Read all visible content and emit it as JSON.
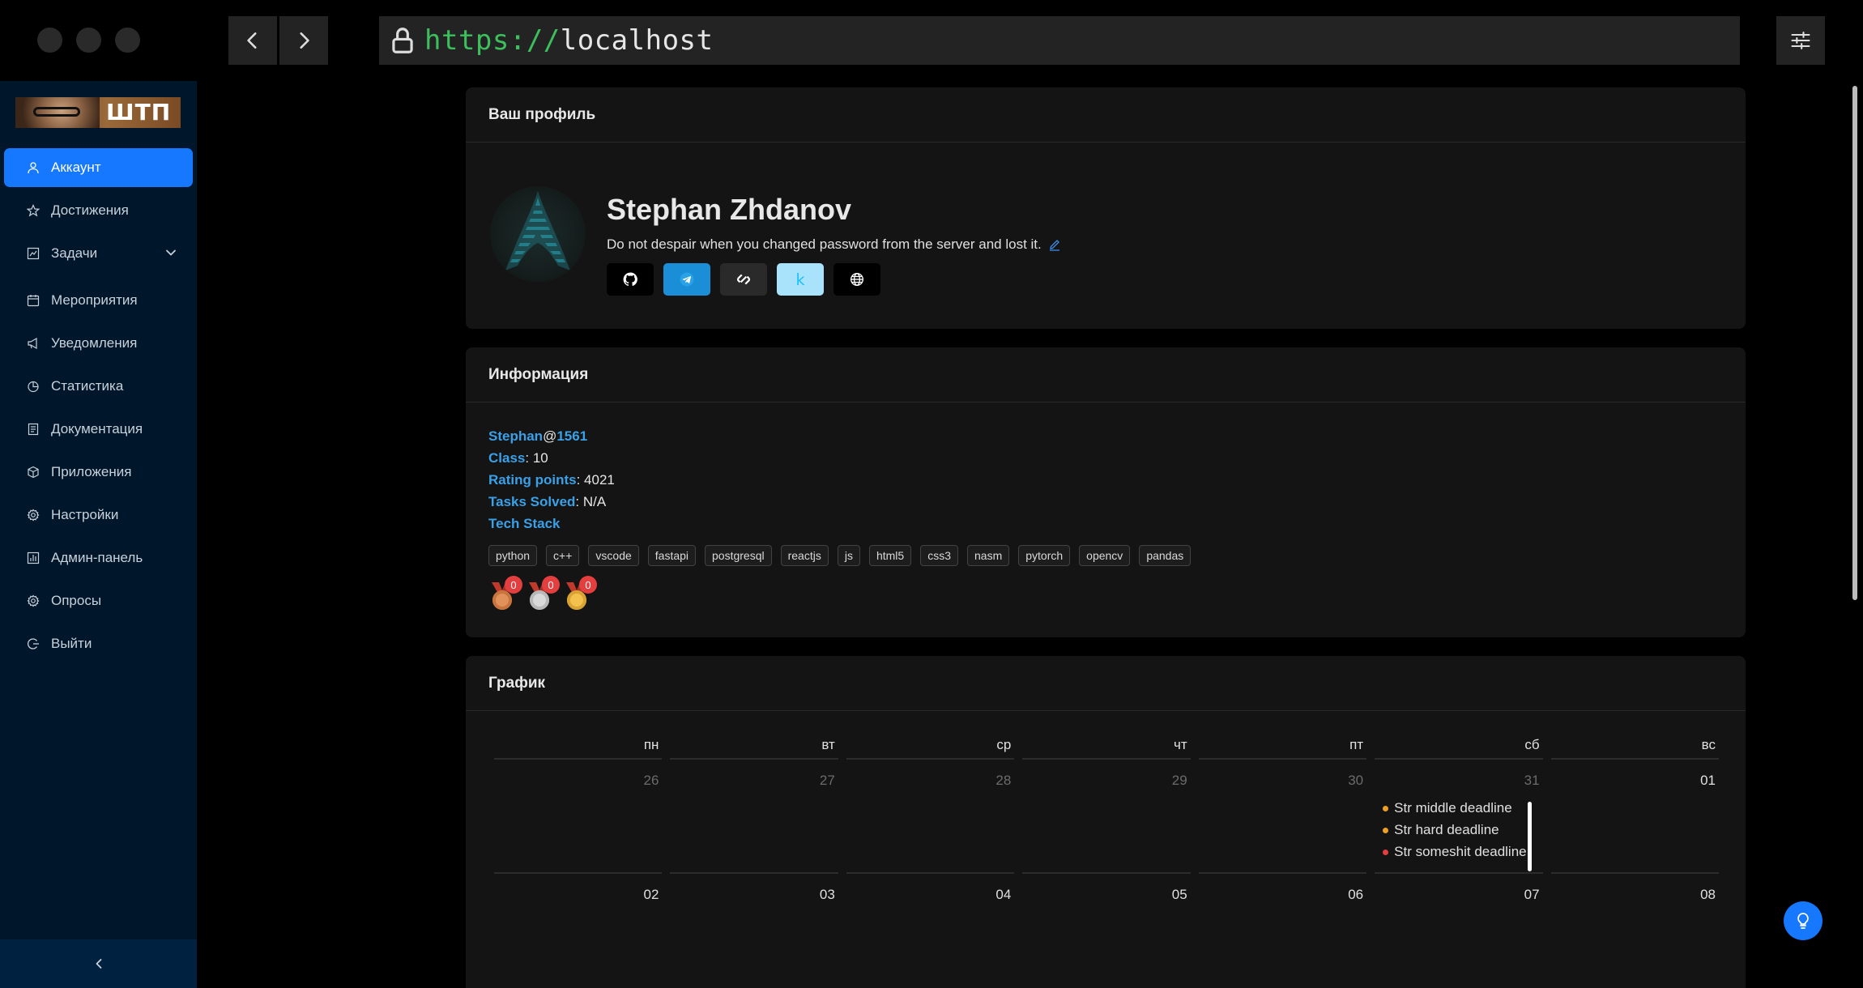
{
  "browser": {
    "url_scheme": "https://",
    "url_host": "localhost"
  },
  "sidebar": {
    "logo_text": "ШТП",
    "items": [
      {
        "label": "Аккаунт",
        "icon": "user-icon",
        "active": true
      },
      {
        "label": "Достижения",
        "icon": "star-icon"
      },
      {
        "label": "Задачи",
        "icon": "chart-icon",
        "has_submenu": true
      },
      {
        "label": "Мероприятия",
        "icon": "calendar-icon"
      },
      {
        "label": "Уведомления",
        "icon": "megaphone-icon"
      },
      {
        "label": "Статистика",
        "icon": "pie-chart-icon"
      },
      {
        "label": "Документация",
        "icon": "document-icon"
      },
      {
        "label": "Приложения",
        "icon": "box-icon"
      },
      {
        "label": "Настройки",
        "icon": "gear-icon"
      },
      {
        "label": "Админ-панель",
        "icon": "dashboard-icon"
      },
      {
        "label": "Опросы",
        "icon": "gear-icon"
      },
      {
        "label": "Выйти",
        "icon": "logout-icon"
      }
    ]
  },
  "profile": {
    "card_title": "Ваш профиль",
    "name": "Stephan Zhdanov",
    "status": "Do not despair when you changed password from the server and lost it.",
    "socials": [
      "github-icon",
      "telegram-icon",
      "stepik-icon",
      "kaggle-icon",
      "globe-icon"
    ]
  },
  "info": {
    "card_title": "Информация",
    "username": "Stephan",
    "at": "@",
    "user_id": "1561",
    "class_label": "Class",
    "class_value": ": 10",
    "rating_label": "Rating points",
    "rating_value": ": 4021",
    "tasks_label": "Tasks Solved",
    "tasks_value": ": N/A",
    "stack_label": "Tech Stack",
    "tags": [
      "python",
      "c++",
      "vscode",
      "fastapi",
      "postgresql",
      "reactjs",
      "js",
      "html5",
      "css3",
      "nasm",
      "pytorch",
      "opencv",
      "pandas"
    ],
    "medals": [
      {
        "type": "bronze",
        "count": "0",
        "color": "#e0925a"
      },
      {
        "type": "silver",
        "count": "0",
        "color": "#d9d9d9"
      },
      {
        "type": "gold",
        "count": "0",
        "color": "#f2c14e"
      }
    ]
  },
  "schedule": {
    "card_title": "График",
    "weekdays": [
      "пн",
      "вт",
      "ср",
      "чт",
      "пт",
      "сб",
      "вс"
    ],
    "week1": [
      {
        "day": "26",
        "dim": true
      },
      {
        "day": "27",
        "dim": true
      },
      {
        "day": "28",
        "dim": true
      },
      {
        "day": "29",
        "dim": true
      },
      {
        "day": "30",
        "dim": true
      },
      {
        "day": "31",
        "dim": true,
        "events": [
          {
            "text": "Str middle deadline",
            "color": "#f0a020"
          },
          {
            "text": "Str hard deadline",
            "color": "#f0a020"
          },
          {
            "text": "Str someshit deadline",
            "color": "#e53e3e"
          }
        ]
      },
      {
        "day": "01",
        "dim": false
      }
    ],
    "week2": [
      "02",
      "03",
      "04",
      "05",
      "06",
      "07",
      "08"
    ]
  }
}
